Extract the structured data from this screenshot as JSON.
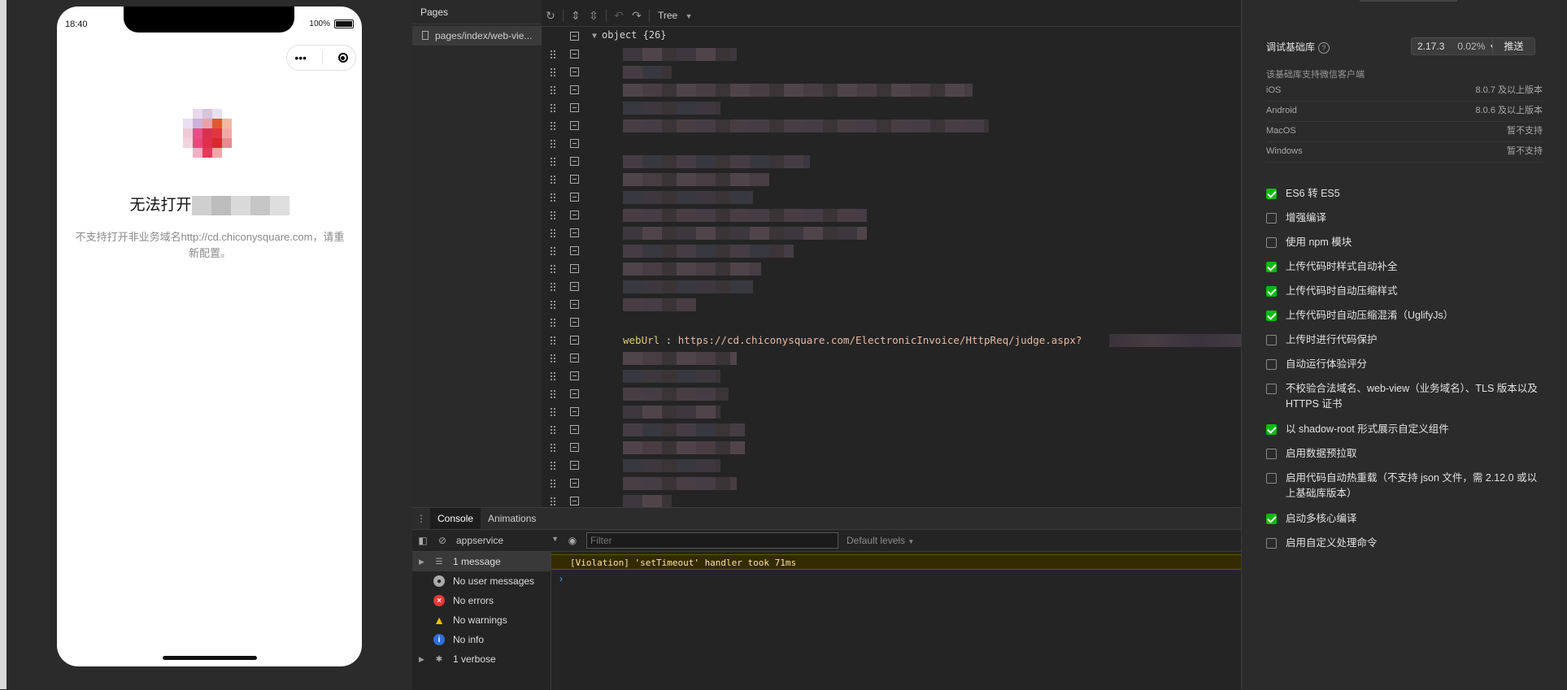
{
  "simulator": {
    "status_time": "18:40",
    "battery_pct": "100%",
    "capsule_dots": "•••",
    "error_title": "无法打开",
    "error_desc": "不支持打开非业务域名http://cd.chiconysquare.com，请重新配置。"
  },
  "pages_panel": {
    "title": "Pages",
    "item": "pages/index/web-vie..."
  },
  "tree_panel": {
    "mode": "Tree",
    "root": "object {26}",
    "weburl_key": "webUrl",
    "weburl_value": "https://cd.chiconysquare.com/ElectronicInvoice/HttpReq/judge.aspx?"
  },
  "console": {
    "tabs": [
      "Console",
      "Animations"
    ],
    "context": "appservice",
    "filter_placeholder": "Filter",
    "levels": "Default levels",
    "sidebar": [
      {
        "label": "1 message",
        "icon": "list-icon"
      },
      {
        "label": "No user messages",
        "icon": "user-icon"
      },
      {
        "label": "No errors",
        "icon": "error-icon"
      },
      {
        "label": "No warnings",
        "icon": "warning-icon"
      },
      {
        "label": "No info",
        "icon": "info-icon"
      },
      {
        "label": "1 verbose",
        "icon": "bug-icon"
      }
    ],
    "violation": "[Violation] 'setTimeout' handler took 71ms"
  },
  "settings": {
    "base_lib_label": "调试基础库",
    "version": "2.17.3",
    "version_pct": "0.02%",
    "push_label": "推送",
    "support_title": "该基础库支持微信客户端",
    "platforms": [
      {
        "name": "iOS",
        "value": "8.0.7 及以上版本"
      },
      {
        "name": "Android",
        "value": "8.0.6 及以上版本"
      },
      {
        "name": "MacOS",
        "value": "暂不支持"
      },
      {
        "name": "Windows",
        "value": "暂不支持"
      }
    ],
    "options": [
      {
        "label": "ES6 转 ES5",
        "checked": true
      },
      {
        "label": "增强编译",
        "checked": false
      },
      {
        "label": "使用 npm 模块",
        "checked": false
      },
      {
        "label": "上传代码时样式自动补全",
        "checked": true
      },
      {
        "label": "上传代码时自动压缩样式",
        "checked": true
      },
      {
        "label": "上传代码时自动压缩混淆（UglifyJs）",
        "checked": true
      },
      {
        "label": "上传时进行代码保护",
        "checked": false
      },
      {
        "label": "自动运行体验评分",
        "checked": false
      },
      {
        "label": "不校验合法域名、web-view（业务域名）、TLS 版本以及 HTTPS 证书",
        "checked": false
      },
      {
        "label": "以 shadow-root 形式展示自定义组件",
        "checked": true
      },
      {
        "label": "启用数据预拉取",
        "checked": false
      },
      {
        "label": "启用代码自动热重载（不支持 json 文件，需 2.12.0 或以上基础库版本）",
        "checked": false
      },
      {
        "label": "启动多核心编译",
        "checked": true
      },
      {
        "label": "启用自定义处理命令",
        "checked": false
      }
    ]
  }
}
